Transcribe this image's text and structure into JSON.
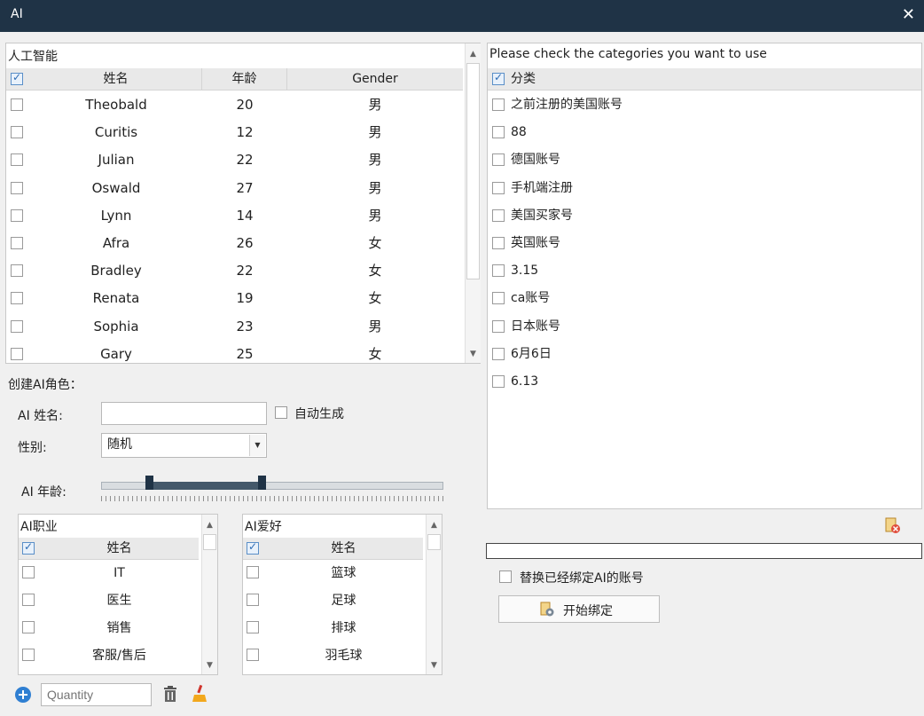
{
  "window": {
    "title": "AI",
    "close_glyph": "✕"
  },
  "ai_table": {
    "caption": "人工智能",
    "header_checked": true,
    "columns": [
      "姓名",
      "年龄",
      "Gender"
    ],
    "rows": [
      {
        "name": "Theobald",
        "age": "20",
        "gender": "男"
      },
      {
        "name": "Curitis",
        "age": "12",
        "gender": "男"
      },
      {
        "name": "Julian",
        "age": "22",
        "gender": "男"
      },
      {
        "name": "Oswald",
        "age": "27",
        "gender": "男"
      },
      {
        "name": "Lynn",
        "age": "14",
        "gender": "男"
      },
      {
        "name": "Afra",
        "age": "26",
        "gender": "女"
      },
      {
        "name": "Bradley",
        "age": "22",
        "gender": "女"
      },
      {
        "name": "Renata",
        "age": "19",
        "gender": "女"
      },
      {
        "name": "Sophia",
        "age": "23",
        "gender": "男"
      },
      {
        "name": "Gary",
        "age": "25",
        "gender": "女"
      }
    ]
  },
  "create_form": {
    "section_label": "创建AI角色：",
    "name_label": "AI 姓名:",
    "name_value": "",
    "auto_generate_label": "自动生成",
    "gender_label": "性别:",
    "gender_value": "随机",
    "age_label": "AI 年龄:",
    "age_range_fraction": [
      0.14,
      0.47
    ]
  },
  "job_list": {
    "caption": "AI职业",
    "column": "姓名",
    "items": [
      "IT",
      "医生",
      "销售",
      "客服/售后"
    ]
  },
  "hobby_list": {
    "caption": "AI爱好",
    "column": "姓名",
    "items": [
      "篮球",
      "足球",
      "排球",
      "羽毛球"
    ]
  },
  "toolbar": {
    "add_icon": "plus-circle-icon",
    "quantity_placeholder": "Quantity",
    "delete_icon": "trash-icon",
    "clear_icon": "broom-icon"
  },
  "categories": {
    "caption": "Please check the categories you want to use",
    "header": "分类",
    "header_checked": true,
    "items": [
      "之前注册的美国账号",
      "88",
      "德国账号",
      "手机端注册",
      "美国买家号",
      "英国账号",
      "3.15",
      "ca账号",
      "日本账号",
      "6月6日",
      "6.13"
    ]
  },
  "bind": {
    "replace_label": "替换已经绑定AI的账号",
    "start_button": "开始绑定"
  },
  "colors": {
    "titlebar": "#1f3346",
    "slider_range": "#44586a",
    "accent_check": "#2f6db5"
  }
}
